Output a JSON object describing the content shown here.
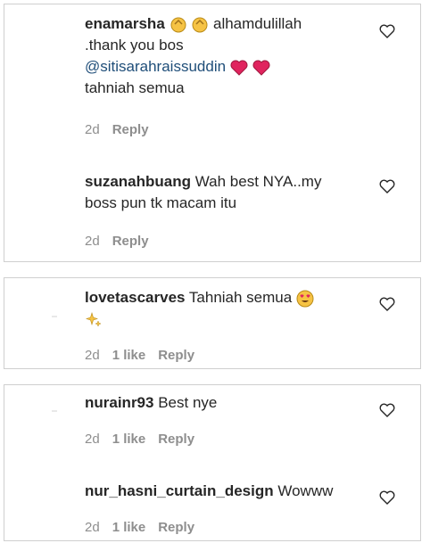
{
  "comments_group_1": {
    "c1": {
      "username": "enamarsha",
      "text_after_emoji": "alhamdulillah",
      "line2": ".thank you bos",
      "mention": "@sitisarahraissuddin",
      "line4": "tahniah semua",
      "time": "2d",
      "reply": "Reply",
      "emoji_1": "clapping-hands",
      "emoji_2": "red-heart"
    },
    "c2": {
      "username": "suzanahbuang",
      "text": "Wah best NYA..my",
      "line2": "boss pun tk macam itu",
      "time": "2d",
      "reply": "Reply"
    }
  },
  "comments_group_2": {
    "c1": {
      "username": "lovetascarves",
      "text": "Tahniah semua",
      "time": "2d",
      "likes": "1 like",
      "reply": "Reply",
      "emoji_1": "heart-eyes",
      "emoji_2": "sparkles"
    }
  },
  "comments_group_3": {
    "c1": {
      "username": "nurainr93",
      "text": "Best nye",
      "time": "2d",
      "likes": "1 like",
      "reply": "Reply"
    },
    "c2": {
      "username": "nur_hasni_curtain_design",
      "text": "Wowww",
      "time": "2d",
      "likes": "1 like",
      "reply": "Reply"
    }
  },
  "colors": {
    "text": "#262626",
    "muted": "#8e8e8e",
    "mention": "#1f4e79",
    "heart": "#e0245e",
    "border": "#cfcfcf"
  }
}
